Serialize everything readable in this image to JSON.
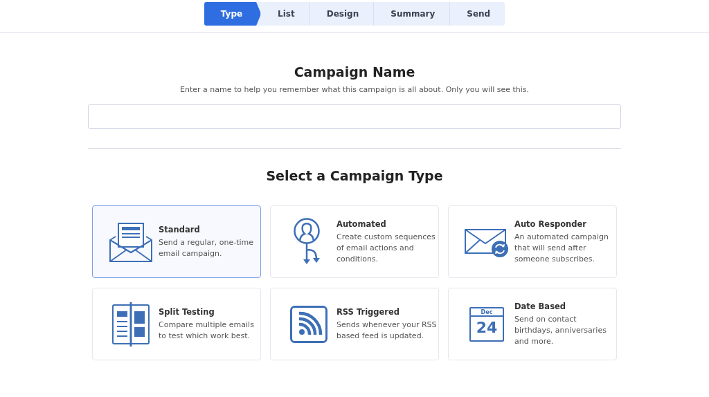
{
  "steps": [
    {
      "label": "Type",
      "selected": true
    },
    {
      "label": "List",
      "selected": false
    },
    {
      "label": "Design",
      "selected": false
    },
    {
      "label": "Summary",
      "selected": false
    },
    {
      "label": "Send",
      "selected": false
    }
  ],
  "campaign_name": {
    "title": "Campaign Name",
    "hint": "Enter a name to help you remember what this campaign is all about. Only you will see this."
  },
  "campaign_type": {
    "title": "Select a Campaign Type",
    "cards": [
      {
        "kind": "standard",
        "title": "Standard",
        "description": "Send a regular, one-time email campaign.",
        "selected": true
      },
      {
        "kind": "automated",
        "title": "Automated",
        "description": "Create custom sequences of email actions and conditions.",
        "selected": false
      },
      {
        "kind": "responder",
        "title": "Auto Responder",
        "description": "An automated campaign that will send after someone subscribes.",
        "selected": false
      },
      {
        "kind": "split",
        "title": "Split Testing",
        "description": "Compare multiple emails to test which work best.",
        "selected": false
      },
      {
        "kind": "rss",
        "title": "RSS Triggered",
        "description": "Sends whenever your RSS based feed is updated.",
        "selected": false
      },
      {
        "kind": "date",
        "title": "Date Based",
        "description": "Send on contact birthdays, anniversaries and more.",
        "selected": false,
        "calendar_month": "Dec",
        "calendar_day": "24"
      }
    ]
  }
}
